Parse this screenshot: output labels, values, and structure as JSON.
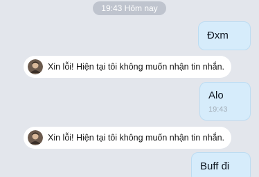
{
  "date_separator": "19:43 Hôm nay",
  "messages": [
    {
      "type": "outgoing",
      "text": "Đxm",
      "time": ""
    },
    {
      "type": "system",
      "text": "Xin lỗi! Hiện tại tôi không muốn nhận tin nhắn.",
      "avatar_icon": "user-avatar"
    },
    {
      "type": "outgoing",
      "text": "Alo",
      "time": "19:43"
    },
    {
      "type": "system",
      "text": "Xin lỗi! Hiện tại tôi không muốn nhận tin nhắn.",
      "avatar_icon": "user-avatar"
    },
    {
      "type": "outgoing",
      "text": "Buff đi",
      "time": ""
    }
  ],
  "colors": {
    "background": "#e3e6ec",
    "outgoing_bubble": "#d6ecfb",
    "system_pill": "#ffffff",
    "date_pill": "#bfc4ce"
  }
}
